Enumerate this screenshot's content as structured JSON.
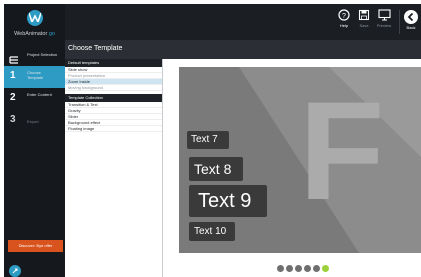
{
  "app": {
    "logo_text": "WebAnimator",
    "logo_suffix": "go"
  },
  "sidebar": {
    "steps": [
      {
        "num": "",
        "label": "Project Selection",
        "icon": "layers-icon"
      },
      {
        "num": "1",
        "label": "Choose Template"
      },
      {
        "num": "2",
        "label": "Enter Content"
      },
      {
        "num": "3",
        "label": "Export"
      }
    ],
    "discover_label": "Discover: Bye offer",
    "help_icon": "help-icon"
  },
  "toolbar": {
    "help": "Help",
    "save": "Save",
    "preview": "Preview",
    "back": "Back"
  },
  "header": {
    "title": "Choose Template"
  },
  "templates": {
    "default_heading": "Default templates",
    "default_items": [
      {
        "label": "Slide show",
        "state": "normal"
      },
      {
        "label": "Product presentation",
        "state": "dim"
      },
      {
        "label": "Zoom Inside",
        "state": "selected"
      },
      {
        "label": "Moving background",
        "state": "dim"
      }
    ],
    "collection_heading": "Template Collection",
    "collection_items": [
      {
        "label": "Transition & Text"
      },
      {
        "label": "Gravity"
      },
      {
        "label": "Slider"
      },
      {
        "label": "Background effect"
      },
      {
        "label": "Floating image"
      }
    ]
  },
  "preview": {
    "big_letter": "F",
    "text_boxes": [
      "Text 7",
      "Text 8",
      "Text 9",
      "Text 10"
    ],
    "dot_count": 6,
    "active_dot": 5,
    "colors": {
      "stage": "#838383",
      "dot_active": "#9bd13a",
      "accent": "#2d9bc4",
      "discover": "#d9531e"
    }
  }
}
